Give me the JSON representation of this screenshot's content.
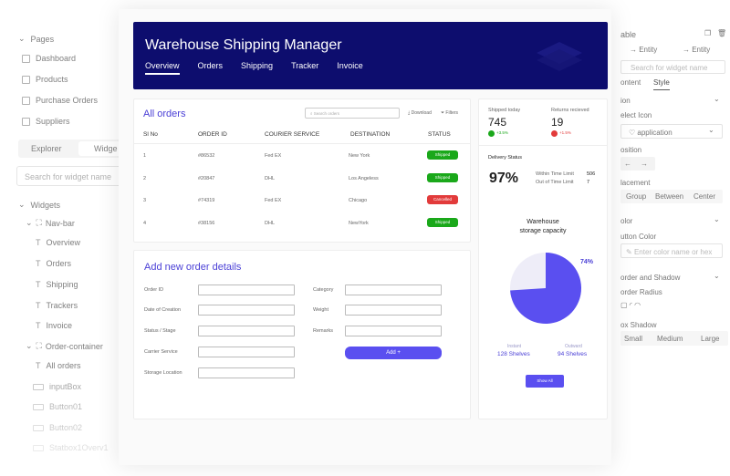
{
  "left_panel": {
    "pages_header": "Pages",
    "pages": [
      "Dashboard",
      "Products",
      "Purchase Orders",
      "Suppliers"
    ],
    "tabs": [
      "Explorer",
      "Widge"
    ],
    "search_placeholder": "Search for widget name",
    "widgets_header": "Widgets",
    "navbar": "Nav-bar",
    "navbar_items": [
      "Overview",
      "Orders",
      "Shipping",
      "Trackers",
      "Invoice"
    ],
    "order_container": "Order-container",
    "order_items": [
      "All orders",
      "inputBox",
      "Button01",
      "Button02",
      "Statbox1Overv1"
    ]
  },
  "header": {
    "title": "Warehouse Shipping Manager",
    "nav": [
      "Overview",
      "Orders",
      "Shipping",
      "Tracker",
      "Invoice"
    ]
  },
  "orders": {
    "title": "All orders",
    "search_placeholder": "Search orders",
    "download": "Download",
    "filters": "Filters",
    "columns": [
      "Sl No",
      "ORDER ID",
      "COURIER SERVICE",
      "DESTINATION",
      "STATUS"
    ],
    "rows": [
      {
        "sl": "1",
        "id": "#86532",
        "courier": "Fed EX",
        "dest": "New York",
        "status": "Shipped"
      },
      {
        "sl": "2",
        "id": "#20847",
        "courier": "DHL",
        "dest": "Los Angeless",
        "status": "Shipped"
      },
      {
        "sl": "3",
        "id": "#74319",
        "courier": "Fed EX",
        "dest": "Chicago",
        "status": "Cancelled"
      },
      {
        "sl": "4",
        "id": "#38156",
        "courier": "DHL",
        "dest": "NewYork",
        "status": "Shipped"
      }
    ],
    "status_colors": {
      "Shipped": "#1aa81a",
      "Cancelled": "#e23b3b"
    }
  },
  "add_order": {
    "title": "Add new order details",
    "left_fields": [
      "Order ID",
      "Date of Creation",
      "Status / Stage",
      "Carrier Service",
      "Storage Location"
    ],
    "right_fields": [
      "Category",
      "Weight",
      "Remarks"
    ],
    "add_button": "Add +"
  },
  "stats": {
    "shipped_label": "Shipped today",
    "shipped_value": "745",
    "shipped_change": "+3.5%",
    "returns_label": "Returns recieved",
    "returns_value": "19",
    "returns_change": "+1.5%",
    "delivery_label": "Delivery Status",
    "delivery_pct": "97%",
    "within_label": "Within Time Limit",
    "within_value": "506",
    "out_label": "Out of Time Limit",
    "out_value": "7",
    "storage_title_1": "Warehouse",
    "storage_title_2": "storage capacity",
    "capacity_pct": "74%",
    "capacity_fraction": 0.74,
    "instant_label": "Instant",
    "instant_value": "128 Shelves",
    "outward_label": "Outward",
    "outward_value": "94 Shelves",
    "show_all": "Show All"
  },
  "right_panel": {
    "title": "able",
    "entity1": "→ Entity",
    "entity2": "→ Entity",
    "search_placeholder": "Search for widget name",
    "tabs": [
      "ontent",
      "Style"
    ],
    "section_icon": "ion",
    "select_icon_label": "elect Icon",
    "icon_value": "application",
    "position_label": "osition",
    "placement_label": "lacement",
    "placement_opts": [
      "Group",
      "Between",
      "Center"
    ],
    "color_section": "olor",
    "button_color_label": "utton Color",
    "color_placeholder": "Enter color name or hex",
    "border_section": "order and Shadow",
    "border_radius_label": "order Radius",
    "box_shadow_label": "ox Shadow",
    "shadow_opts": [
      "Small",
      "Medium",
      "Large"
    ]
  }
}
